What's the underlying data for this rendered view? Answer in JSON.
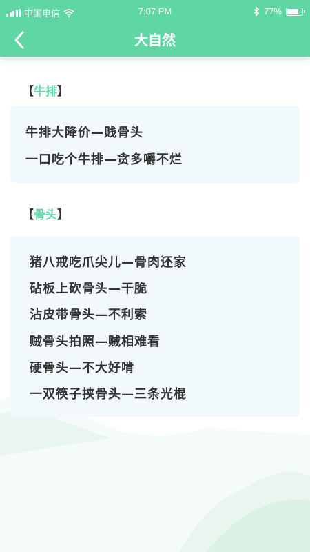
{
  "status_bar": {
    "carrier": "中国电信",
    "time": "7:07 PM",
    "battery_percent": "77%",
    "battery_level": 0.77,
    "icons": [
      "signal-icon",
      "wifi-icon",
      "bluetooth-icon",
      "battery-icon"
    ]
  },
  "nav": {
    "title": "大自然",
    "back_icon": "chevron-left-icon"
  },
  "sections": [
    {
      "bracket_open": "【",
      "title": "牛排",
      "bracket_close": "】",
      "lines": [
        "牛排大降价—贱骨头",
        "一口吃个牛排—贪多嚼不烂"
      ]
    },
    {
      "bracket_open": "【",
      "title": "骨头",
      "bracket_close": "】",
      "lines": [
        "猪八戒吃爪尖儿—骨肉还家",
        "砧板上砍骨头—干脆",
        "沾皮带骨头—不利索",
        "贼骨头拍照—贼相难看",
        "硬骨头—不大好啃",
        "一双筷子挟骨头—三条光棍"
      ]
    }
  ],
  "colors": {
    "accent": "#5fd6a4",
    "card_bg": "#f1f9fc",
    "text": "#333333"
  }
}
